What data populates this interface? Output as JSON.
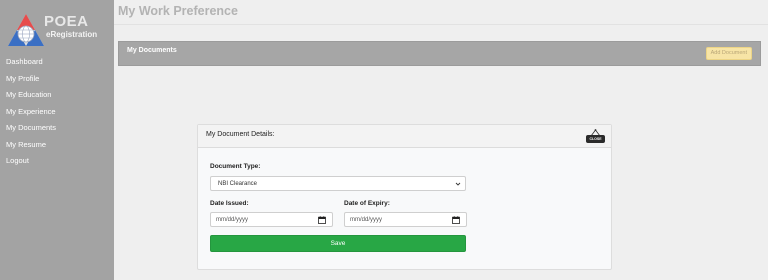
{
  "brand": {
    "title": "POEA",
    "subtitle": "eRegistration"
  },
  "page": {
    "title": "My Work Preference"
  },
  "sidebar": {
    "items": [
      {
        "label": "Dashboard"
      },
      {
        "label": "My Profile"
      },
      {
        "label": "My Education"
      },
      {
        "label": "My Experience"
      },
      {
        "label": "My Documents"
      },
      {
        "label": "My Resume"
      },
      {
        "label": "Logout"
      }
    ]
  },
  "documents": {
    "title": "My Documents",
    "add_label": "Add Document"
  },
  "modal": {
    "title": "My Document Details:",
    "close_label": "CLOSE",
    "document_type_label": "Document Type:",
    "document_type_value": "NBI Clearance",
    "date_issued_label": "Date Issued:",
    "date_issued_placeholder": "mm/dd/yyyy",
    "date_expiry_label": "Date of Expiry:",
    "date_expiry_placeholder": "mm/dd/yyyy",
    "save_label": "Save"
  },
  "colors": {
    "sidebar_bg": "#a3a3a3",
    "save_green": "#28a745",
    "add_doc_yellow": "#f7e4a6",
    "logo_red": "#e74c4c",
    "logo_blue": "#3a6fc4"
  }
}
